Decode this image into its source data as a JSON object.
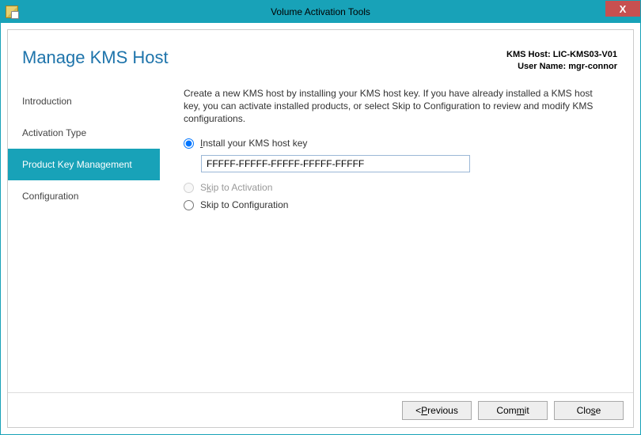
{
  "window": {
    "title": "Volume Activation Tools",
    "close_glyph": "X"
  },
  "header": {
    "page_title": "Manage KMS Host",
    "kms_host_label": "KMS Host:",
    "kms_host_value": "LIC-KMS03-V01",
    "user_name_label": "User Name:",
    "user_name_value": "mgr-connor"
  },
  "sidebar": {
    "items": [
      {
        "label": "Introduction"
      },
      {
        "label": "Activation Type"
      },
      {
        "label": "Product Key Management"
      },
      {
        "label": "Configuration"
      }
    ],
    "active_index": 2
  },
  "main": {
    "instructions": "Create a new KMS host by installing your KMS host key. If you have already installed a KMS host key, you can activate installed products, or select Skip to Configuration to review and modify KMS configurations.",
    "options": {
      "install": {
        "pre": "",
        "u": "I",
        "post": "nstall your KMS host key",
        "selected": true,
        "enabled": true,
        "key_value": "FFFFF-FFFFF-FFFFF-FFFFF-FFFFF"
      },
      "skip_activation": {
        "pre": "S",
        "u": "k",
        "post": "ip to Activation",
        "selected": false,
        "enabled": false
      },
      "skip_config": {
        "pre": "Skip to Confi",
        "u": "g",
        "post": "uration",
        "selected": false,
        "enabled": true
      }
    }
  },
  "footer": {
    "previous": {
      "lt": "<",
      "sp": " ",
      "u": "P",
      "post": "revious"
    },
    "commit": {
      "pre": "Com",
      "u": "m",
      "post": "it"
    },
    "close": {
      "pre": "Clo",
      "u": "s",
      "post": "e"
    }
  }
}
